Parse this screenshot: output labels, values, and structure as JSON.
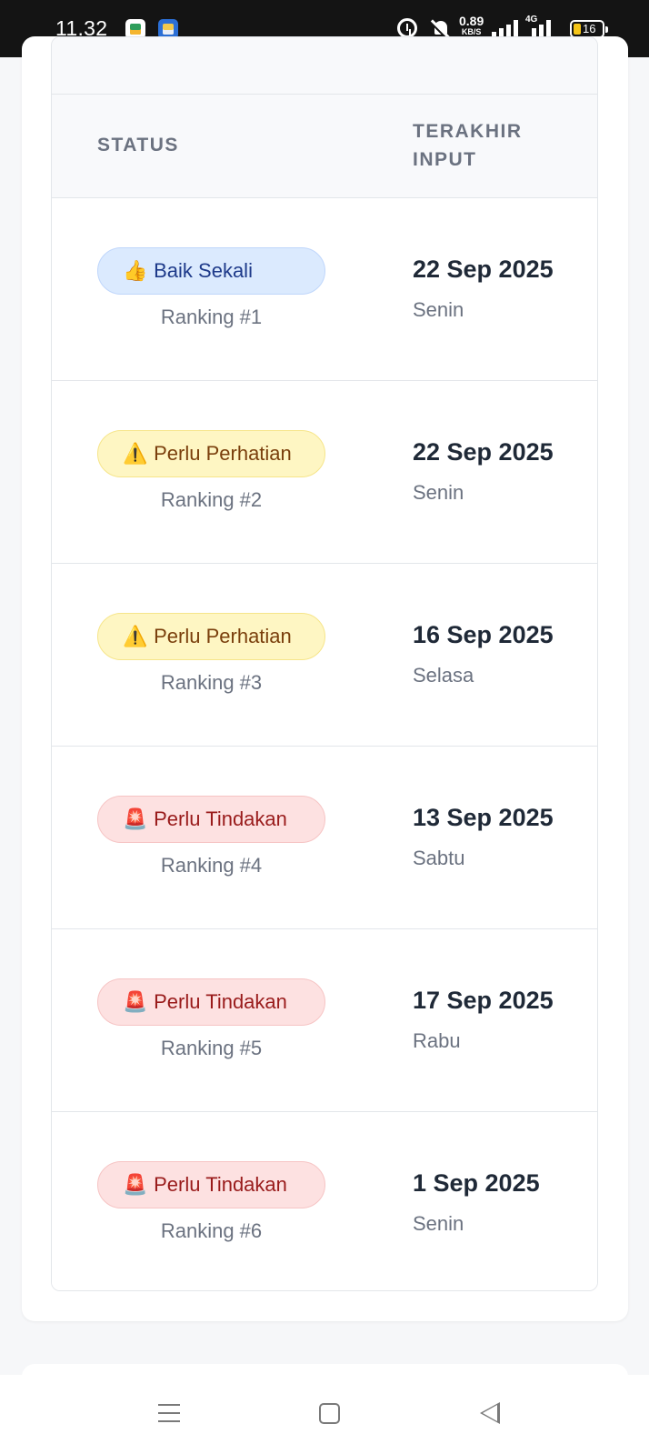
{
  "status_bar": {
    "time": "11.32",
    "net_speed": "0.89",
    "net_speed_unit": "KB/S",
    "network_type": "4G",
    "battery": "16"
  },
  "table": {
    "headers": {
      "status": "STATUS",
      "terakhir_input": "TERAKHIR INPUT"
    },
    "rows": [
      {
        "badge_icon": "👍",
        "badge_label": "Baik Sekali",
        "badge_color": "#dbeafe",
        "ranking": "Ranking #1",
        "date": "22 Sep 2025",
        "day": "Senin"
      },
      {
        "badge_icon": "⚠️",
        "badge_label": "Perlu Perhatian",
        "badge_color": "#fef6c3",
        "ranking": "Ranking #2",
        "date": "22 Sep 2025",
        "day": "Senin"
      },
      {
        "badge_icon": "⚠️",
        "badge_label": "Perlu Perhatian",
        "badge_color": "#fef6c3",
        "ranking": "Ranking #3",
        "date": "16 Sep 2025",
        "day": "Selasa"
      },
      {
        "badge_icon": "🚨",
        "badge_label": "Perlu Tindakan",
        "badge_color": "#fde1e1",
        "ranking": "Ranking #4",
        "date": "13 Sep 2025",
        "day": "Sabtu"
      },
      {
        "badge_icon": "🚨",
        "badge_label": "Perlu Tindakan",
        "badge_color": "#fde1e1",
        "ranking": "Ranking #5",
        "date": "17 Sep 2025",
        "day": "Rabu"
      },
      {
        "badge_icon": "🚨",
        "badge_label": "Perlu Tindakan",
        "badge_color": "#fde1e1",
        "ranking": "Ranking #6",
        "date": "1 Sep 2025",
        "day": "Senin"
      }
    ]
  },
  "nav_bar": {
    "icons": [
      "menu-icon",
      "home-icon",
      "back-icon"
    ]
  }
}
